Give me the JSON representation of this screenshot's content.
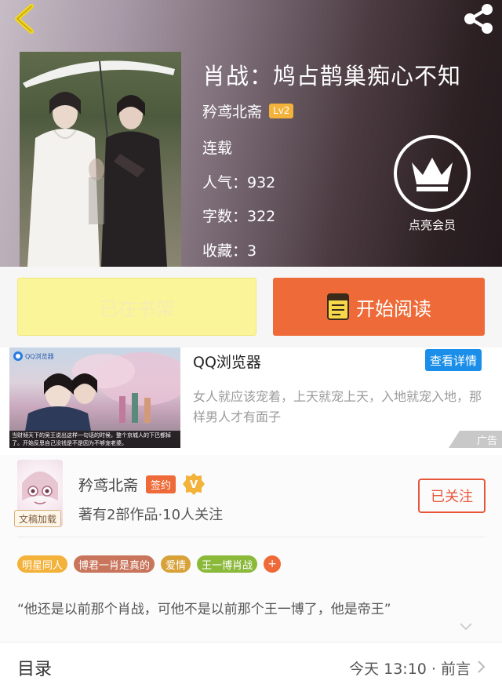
{
  "book": {
    "title": "肖战：鸠占鹊巢痴心不知",
    "author": "矜鸢北斋",
    "author_level": "Lv2",
    "status": "连载",
    "popularity": "人气：932",
    "word_count": "字数：322",
    "favorites": "收藏：3"
  },
  "vip": {
    "label": "点亮会员",
    "icon": "crown-icon"
  },
  "actions": {
    "shelf_label": "已在书架",
    "read_label": "开始阅读"
  },
  "ad": {
    "title": "QQ浏览器",
    "detail_label": "查看详情",
    "description": "女人就应该宠着，上天就宠上天，入地就宠入地，那样男人才有面子",
    "badge": "广告",
    "image_logo": "QQ浏览器",
    "image_caption": "当财倾天下的吴王说出这样一句话的时候，整个京城人的下巴都掉了。开始反思自己没钱是不是因为不够宠老婆。"
  },
  "writer": {
    "name": "矜鸢北斋",
    "sign_badge": "签约",
    "avatar_tag": "文稿加载",
    "stats": "著有2部作品·10人关注",
    "follow_label": "已关注"
  },
  "tags": [
    {
      "label": "明星同人",
      "color": "#f3b23a"
    },
    {
      "label": "博君一肖是真的",
      "color": "#c8755c"
    },
    {
      "label": "爱情",
      "color": "#d8a23a"
    },
    {
      "label": "王一博肖战",
      "color": "#8bb93a"
    }
  ],
  "tag_more": "+",
  "quote": "“他还是以前那个肖战，可他不是以前那个王一博了，他是帝王”",
  "toc": {
    "label": "目录",
    "update": "今天 13:10 · 前言"
  },
  "colors": {
    "accent_orange": "#ee6a38",
    "shelf_yellow": "#fbf59a",
    "ad_blue": "#1a8ee8"
  }
}
